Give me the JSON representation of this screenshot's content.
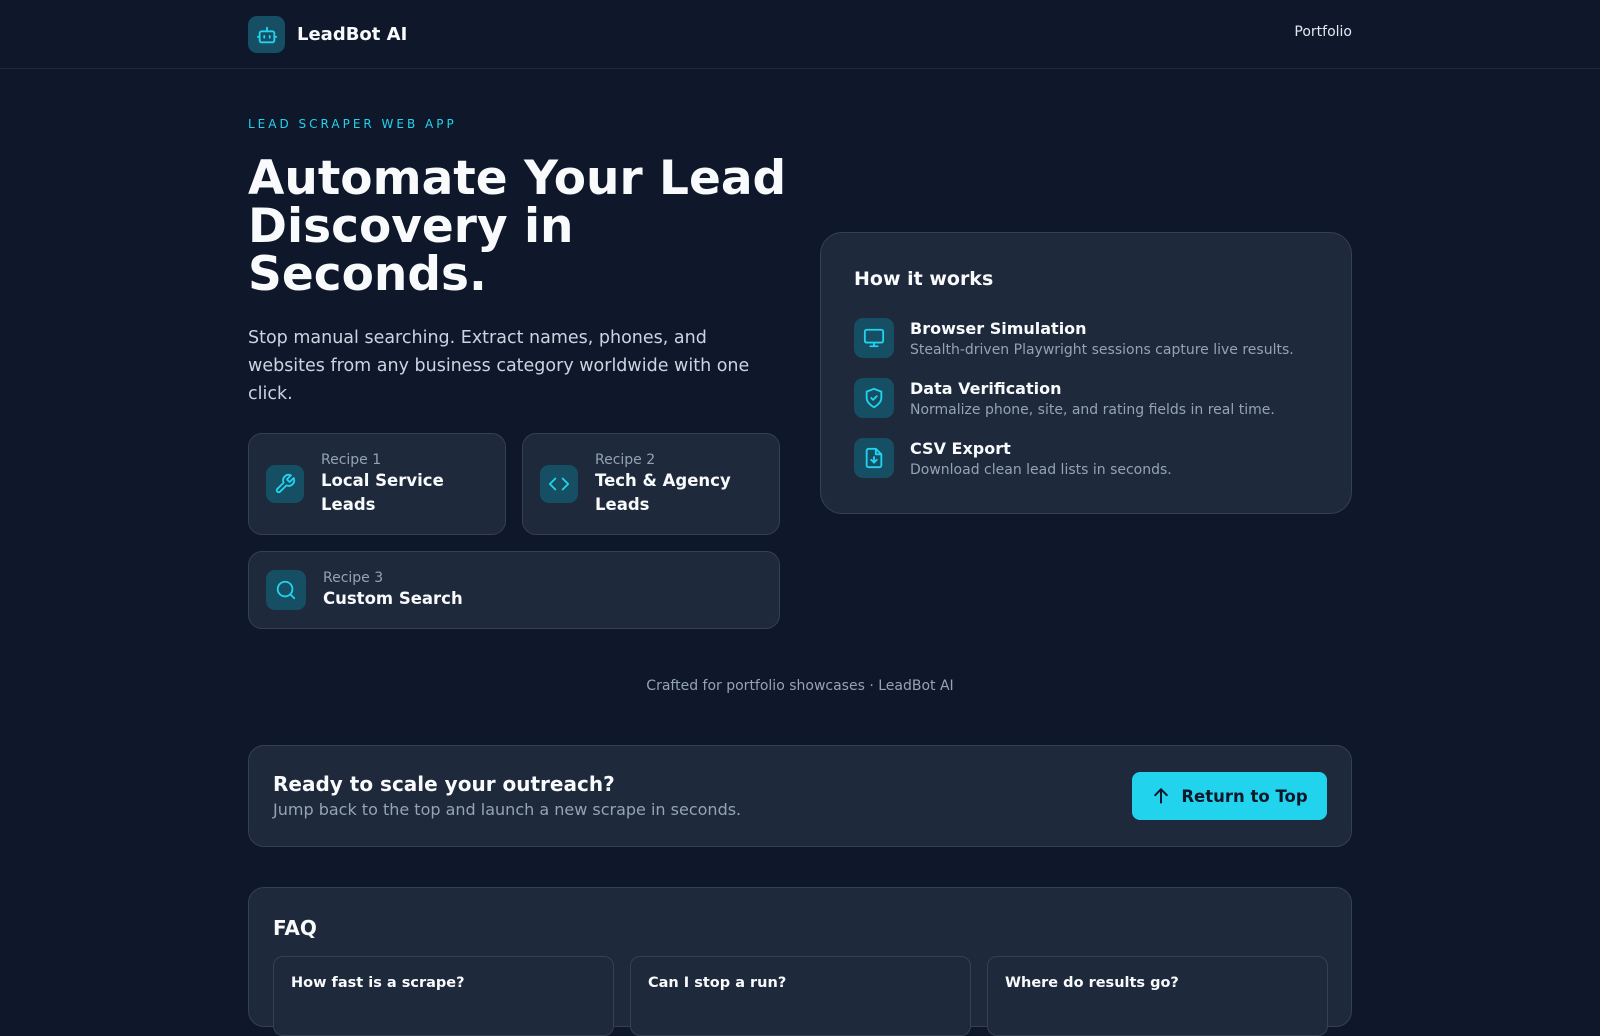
{
  "brand": {
    "name": "LeadBot AI",
    "icon": "robot-icon"
  },
  "nav": {
    "portfolio": "Portfolio"
  },
  "hero": {
    "eyebrow": "LEAD SCRAPER WEB APP",
    "title": "Automate Your Lead Discovery in Seconds.",
    "subtitle": "Stop manual searching. Extract names, phones, and websites from any business category worldwide with one click."
  },
  "recipes": [
    {
      "kicker": "Recipe 1",
      "title": "Local Service Leads",
      "icon": "wrench-icon"
    },
    {
      "kicker": "Recipe 2",
      "title": "Tech & Agency Leads",
      "icon": "code-icon"
    },
    {
      "kicker": "Recipe 3",
      "title": "Custom Search",
      "icon": "search-icon"
    }
  ],
  "how_it_works": {
    "title": "How it works",
    "steps": [
      {
        "title": "Browser Simulation",
        "desc": "Stealth-driven Playwright sessions capture live results.",
        "icon": "monitor-icon"
      },
      {
        "title": "Data Verification",
        "desc": "Normalize phone, site, and rating fields in real time.",
        "icon": "shield-check-icon"
      },
      {
        "title": "CSV Export",
        "desc": "Download clean lead lists in seconds.",
        "icon": "file-download-icon"
      }
    ]
  },
  "footer_note": "Crafted for portfolio showcases · LeadBot AI",
  "cta": {
    "title": "Ready to scale your outreach?",
    "subtitle": "Jump back to the top and launch a new scrape in seconds.",
    "button": "Return to Top",
    "button_icon": "arrow-up-icon"
  },
  "faq": {
    "title": "FAQ",
    "items": [
      {
        "question": "How fast is a scrape?"
      },
      {
        "question": "Can I stop a run?"
      },
      {
        "question": "Where do results go?"
      }
    ]
  },
  "colors": {
    "background": "#0f172a",
    "card": "#1e293b",
    "accent": "#22d3ee",
    "icon_bg": "#164e63"
  }
}
